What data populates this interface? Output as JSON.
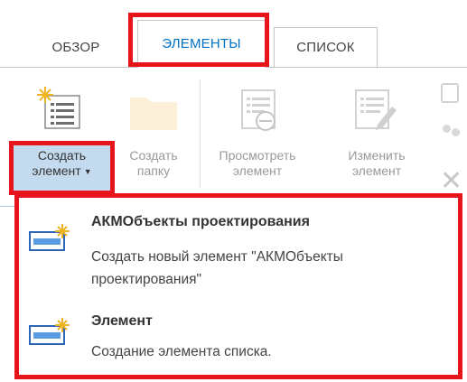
{
  "tabs": [
    {
      "label": "ОБЗОР"
    },
    {
      "label": "ЭЛЕМЕНТЫ"
    },
    {
      "label": "СПИСОК"
    }
  ],
  "ribbon": {
    "create_item": {
      "line1": "Создать",
      "line2": "элемент",
      "icon": "new-item-icon"
    },
    "create_folder": {
      "line1": "Создать",
      "line2": "папку",
      "icon": "folder-icon"
    },
    "view_item": {
      "line1": "Просмотреть",
      "line2": "элемент",
      "icon": "view-item-icon"
    },
    "edit_item": {
      "line1": "Изменить",
      "line2": "элемент",
      "icon": "edit-item-icon"
    }
  },
  "menu": {
    "items": [
      {
        "title": "АКМОбъекты проектирования",
        "description": "Создать новый элемент \"АКМОбъекты проектирования\"",
        "icon": "new-item-icon"
      },
      {
        "title": "Элемент",
        "description": "Создание элемента списка.",
        "icon": "new-item-icon"
      }
    ]
  },
  "colors": {
    "highlight": "#e8141b",
    "accent": "#0072c6",
    "selected_bg": "#c4dbef"
  }
}
